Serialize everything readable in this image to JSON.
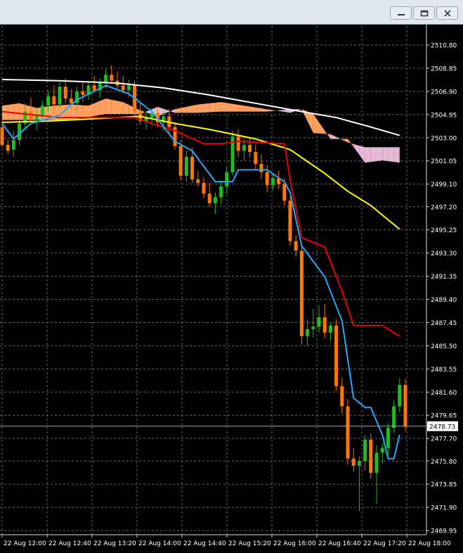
{
  "window": {
    "buttons": [
      "minimize-icon",
      "restore-icon",
      "close-icon"
    ]
  },
  "colors": {
    "background": "#000000",
    "grid": "#666666",
    "candle_bull": "#22bb22",
    "candle_bear": "#ff7700",
    "ma_long": "#ffffff",
    "ma_mid": "#ffff00",
    "kijun": "#ee0000",
    "tenkan": "#22aaff",
    "cloud_bull": "#ffa060",
    "cloud_bear": "#e6b8d6",
    "price_line": "#aaaaaa"
  },
  "chart_data": {
    "type": "candlestick",
    "y_ticks": [
      "2510.80",
      "2508.85",
      "2506.90",
      "2504.95",
      "2503.00",
      "2501.05",
      "2499.10",
      "2497.20",
      "2495.25",
      "2493.30",
      "2491.35",
      "2489.40",
      "2487.45",
      "2485.50",
      "2483.55",
      "2481.60",
      "2479.65",
      "2477.70",
      "2475.80",
      "2473.85",
      "2471.90",
      "2469.95"
    ],
    "x_ticks": [
      "22 Aug 12:00",
      "22 Aug 12:40",
      "22 Aug 13:20",
      "22 Aug 14:00",
      "22 Aug 14:40",
      "22 Aug 15:20",
      "22 Aug 16:00",
      "22 Aug 16:40",
      "22 Aug 17:20",
      "22 Aug 18:00"
    ],
    "current_price": "2478.73",
    "ylim": [
      2469.6,
      2512.4
    ],
    "candles": [
      {
        "o": 2503.9,
        "h": 2504.6,
        "l": 2502.2,
        "c": 2502.4
      },
      {
        "o": 2502.4,
        "h": 2502.9,
        "l": 2501.6,
        "c": 2501.9
      },
      {
        "o": 2502.0,
        "h": 2503.6,
        "l": 2501.4,
        "c": 2502.8
      },
      {
        "o": 2502.8,
        "h": 2504.6,
        "l": 2502.4,
        "c": 2504.2
      },
      {
        "o": 2504.2,
        "h": 2505.9,
        "l": 2503.7,
        "c": 2505.2
      },
      {
        "o": 2505.2,
        "h": 2506.4,
        "l": 2504.3,
        "c": 2504.5
      },
      {
        "o": 2504.5,
        "h": 2505.3,
        "l": 2503.6,
        "c": 2504.9
      },
      {
        "o": 2504.9,
        "h": 2506.1,
        "l": 2504.5,
        "c": 2505.7
      },
      {
        "o": 2505.7,
        "h": 2506.9,
        "l": 2505.2,
        "c": 2506.5
      },
      {
        "o": 2506.5,
        "h": 2507.4,
        "l": 2505.3,
        "c": 2505.8
      },
      {
        "o": 2505.8,
        "h": 2507.8,
        "l": 2505.4,
        "c": 2507.3
      },
      {
        "o": 2507.3,
        "h": 2508.0,
        "l": 2505.9,
        "c": 2506.3
      },
      {
        "o": 2506.3,
        "h": 2507.1,
        "l": 2505.4,
        "c": 2505.9
      },
      {
        "o": 2505.9,
        "h": 2507.3,
        "l": 2505.3,
        "c": 2506.9
      },
      {
        "o": 2506.9,
        "h": 2507.7,
        "l": 2506.0,
        "c": 2506.6
      },
      {
        "o": 2506.6,
        "h": 2507.8,
        "l": 2506.2,
        "c": 2507.4
      },
      {
        "o": 2507.4,
        "h": 2508.2,
        "l": 2506.8,
        "c": 2507.0
      },
      {
        "o": 2507.0,
        "h": 2508.0,
        "l": 2506.4,
        "c": 2507.6
      },
      {
        "o": 2507.6,
        "h": 2508.8,
        "l": 2507.2,
        "c": 2508.3
      },
      {
        "o": 2508.3,
        "h": 2509.1,
        "l": 2507.5,
        "c": 2507.8
      },
      {
        "o": 2507.8,
        "h": 2508.6,
        "l": 2507.0,
        "c": 2507.4
      },
      {
        "o": 2507.4,
        "h": 2508.2,
        "l": 2506.7,
        "c": 2507.0
      },
      {
        "o": 2507.0,
        "h": 2507.9,
        "l": 2506.4,
        "c": 2507.4
      },
      {
        "o": 2507.4,
        "h": 2507.8,
        "l": 2504.8,
        "c": 2505.2
      },
      {
        "o": 2505.2,
        "h": 2505.9,
        "l": 2504.1,
        "c": 2504.4
      },
      {
        "o": 2504.4,
        "h": 2505.2,
        "l": 2503.7,
        "c": 2504.7
      },
      {
        "o": 2504.7,
        "h": 2505.5,
        "l": 2504.0,
        "c": 2505.1
      },
      {
        "o": 2505.1,
        "h": 2505.6,
        "l": 2503.9,
        "c": 2504.3
      },
      {
        "o": 2504.3,
        "h": 2505.2,
        "l": 2503.6,
        "c": 2504.8
      },
      {
        "o": 2504.8,
        "h": 2505.4,
        "l": 2503.4,
        "c": 2503.9
      },
      {
        "o": 2503.9,
        "h": 2504.3,
        "l": 2502.0,
        "c": 2502.3
      },
      {
        "o": 2502.3,
        "h": 2502.8,
        "l": 2499.4,
        "c": 2499.8
      },
      {
        "o": 2499.8,
        "h": 2501.9,
        "l": 2499.3,
        "c": 2501.4
      },
      {
        "o": 2501.4,
        "h": 2502.2,
        "l": 2499.2,
        "c": 2499.5
      },
      {
        "o": 2499.5,
        "h": 2500.2,
        "l": 2498.9,
        "c": 2499.2
      },
      {
        "o": 2499.2,
        "h": 2499.7,
        "l": 2497.9,
        "c": 2498.3
      },
      {
        "o": 2498.3,
        "h": 2499.2,
        "l": 2497.2,
        "c": 2497.5
      },
      {
        "o": 2497.5,
        "h": 2498.4,
        "l": 2496.6,
        "c": 2498.0
      },
      {
        "o": 2498.0,
        "h": 2499.4,
        "l": 2497.4,
        "c": 2498.9
      },
      {
        "o": 2498.9,
        "h": 2500.5,
        "l": 2498.3,
        "c": 2500.1
      },
      {
        "o": 2500.1,
        "h": 2503.6,
        "l": 2499.8,
        "c": 2503.1
      },
      {
        "o": 2503.1,
        "h": 2503.7,
        "l": 2501.4,
        "c": 2501.9
      },
      {
        "o": 2501.9,
        "h": 2502.9,
        "l": 2501.1,
        "c": 2502.4
      },
      {
        "o": 2502.4,
        "h": 2503.0,
        "l": 2501.3,
        "c": 2501.8
      },
      {
        "o": 2501.8,
        "h": 2502.4,
        "l": 2500.3,
        "c": 2500.8
      },
      {
        "o": 2500.8,
        "h": 2501.6,
        "l": 2499.5,
        "c": 2500.1
      },
      {
        "o": 2500.1,
        "h": 2500.7,
        "l": 2498.4,
        "c": 2499.0
      },
      {
        "o": 2499.0,
        "h": 2500.0,
        "l": 2498.6,
        "c": 2499.6
      },
      {
        "o": 2499.6,
        "h": 2500.2,
        "l": 2498.7,
        "c": 2499.1
      },
      {
        "o": 2499.1,
        "h": 2499.6,
        "l": 2497.3,
        "c": 2497.7
      },
      {
        "o": 2497.7,
        "h": 2498.1,
        "l": 2493.9,
        "c": 2494.3
      },
      {
        "o": 2494.3,
        "h": 2494.8,
        "l": 2493.0,
        "c": 2493.5
      },
      {
        "o": 2493.5,
        "h": 2493.9,
        "l": 2485.6,
        "c": 2486.3
      },
      {
        "o": 2486.3,
        "h": 2487.7,
        "l": 2485.5,
        "c": 2486.9
      },
      {
        "o": 2486.9,
        "h": 2488.6,
        "l": 2486.2,
        "c": 2487.1
      },
      {
        "o": 2487.1,
        "h": 2488.9,
        "l": 2486.6,
        "c": 2487.9
      },
      {
        "o": 2487.9,
        "h": 2489.0,
        "l": 2486.1,
        "c": 2486.6
      },
      {
        "o": 2486.6,
        "h": 2487.5,
        "l": 2485.9,
        "c": 2487.2
      },
      {
        "o": 2487.2,
        "h": 2487.7,
        "l": 2481.7,
        "c": 2482.1
      },
      {
        "o": 2482.1,
        "h": 2482.8,
        "l": 2479.8,
        "c": 2480.4
      },
      {
        "o": 2480.4,
        "h": 2481.0,
        "l": 2475.5,
        "c": 2476.0
      },
      {
        "o": 2476.0,
        "h": 2476.9,
        "l": 2474.9,
        "c": 2475.4
      },
      {
        "o": 2475.4,
        "h": 2476.2,
        "l": 2471.6,
        "c": 2475.8
      },
      {
        "o": 2475.8,
        "h": 2478.0,
        "l": 2475.0,
        "c": 2477.6
      },
      {
        "o": 2477.6,
        "h": 2478.1,
        "l": 2474.3,
        "c": 2474.8
      },
      {
        "o": 2474.8,
        "h": 2477.1,
        "l": 2472.2,
        "c": 2476.5
      },
      {
        "o": 2476.5,
        "h": 2477.3,
        "l": 2475.6,
        "c": 2476.9
      },
      {
        "o": 2476.9,
        "h": 2479.0,
        "l": 2476.3,
        "c": 2478.6
      },
      {
        "o": 2478.6,
        "h": 2480.9,
        "l": 2478.2,
        "c": 2480.4
      },
      {
        "o": 2480.4,
        "h": 2482.8,
        "l": 2479.9,
        "c": 2482.2
      },
      {
        "o": 2482.2,
        "h": 2482.7,
        "l": 2478.3,
        "c": 2478.7
      }
    ],
    "series": [
      {
        "role": "ma_long",
        "values": [
          [
            0,
            2507.9
          ],
          [
            10,
            2507.8
          ],
          [
            20,
            2507.6
          ],
          [
            28,
            2507.2
          ],
          [
            36,
            2506.6
          ],
          [
            44,
            2505.9
          ],
          [
            52,
            2505.2
          ],
          [
            58,
            2504.7
          ],
          [
            64,
            2503.9
          ],
          [
            69,
            2503.2
          ]
        ]
      },
      {
        "role": "ma_mid",
        "values": [
          [
            0,
            2504.3
          ],
          [
            8,
            2504.4
          ],
          [
            16,
            2504.6
          ],
          [
            24,
            2504.8
          ],
          [
            30,
            2504.2
          ],
          [
            36,
            2503.7
          ],
          [
            44,
            2502.9
          ],
          [
            50,
            2502.0
          ],
          [
            56,
            2500.0
          ],
          [
            60,
            2498.5
          ],
          [
            64,
            2497.3
          ],
          [
            69,
            2495.3
          ]
        ]
      },
      {
        "role": "kijun",
        "values": [
          [
            0,
            2505.2
          ],
          [
            10,
            2504.7
          ],
          [
            23,
            2504.7
          ],
          [
            26,
            2504.2
          ],
          [
            30,
            2503.6
          ],
          [
            35,
            2502.5
          ],
          [
            38,
            2502.5
          ],
          [
            41,
            2502.7
          ],
          [
            49,
            2502.5
          ],
          [
            50,
            2499.4
          ],
          [
            52,
            2494.6
          ],
          [
            56,
            2493.8
          ],
          [
            59,
            2490.1
          ],
          [
            61,
            2487.2
          ],
          [
            66,
            2487.2
          ],
          [
            69,
            2486.3
          ]
        ]
      },
      {
        "role": "tenkan",
        "values": [
          [
            0,
            2504.2
          ],
          [
            2,
            2502.9
          ],
          [
            5,
            2504.2
          ],
          [
            10,
            2504.9
          ],
          [
            13,
            2506.2
          ],
          [
            18,
            2507.4
          ],
          [
            22,
            2506.7
          ],
          [
            26,
            2505.2
          ],
          [
            30,
            2502.7
          ],
          [
            33,
            2501.9
          ],
          [
            37,
            2499.3
          ],
          [
            40,
            2499.3
          ],
          [
            41,
            2500.3
          ],
          [
            46,
            2500.3
          ],
          [
            49,
            2499.3
          ],
          [
            50,
            2498.4
          ],
          [
            52,
            2493.9
          ],
          [
            56,
            2491.3
          ],
          [
            59,
            2487.6
          ],
          [
            61,
            2481.1
          ],
          [
            63,
            2480.3
          ],
          [
            64,
            2480.3
          ],
          [
            66,
            2478.0
          ],
          [
            67,
            2476.0
          ],
          [
            68,
            2476.0
          ],
          [
            69,
            2478.0
          ]
        ]
      },
      {
        "role": "cloud_a",
        "values": [
          [
            0,
            2505.7
          ],
          [
            3,
            2505.9
          ],
          [
            6,
            2505.5
          ],
          [
            9,
            2505.7
          ],
          [
            12,
            2505.8
          ],
          [
            15,
            2505.7
          ],
          [
            18,
            2506.3
          ],
          [
            21,
            2506.0
          ],
          [
            24,
            2505.3
          ],
          [
            27,
            2504.8
          ],
          [
            30,
            2505.4
          ],
          [
            34,
            2505.8
          ],
          [
            38,
            2506.0
          ],
          [
            42,
            2505.7
          ],
          [
            46,
            2505.4
          ],
          [
            50,
            2505.1
          ],
          [
            52,
            2505.4
          ],
          [
            54,
            2505.0
          ],
          [
            57,
            2502.9
          ],
          [
            60,
            2502.9
          ],
          [
            63,
            2500.9
          ],
          [
            66,
            2501.1
          ],
          [
            69,
            2500.9
          ]
        ]
      },
      {
        "role": "cloud_b",
        "values": [
          [
            0,
            2504.5
          ],
          [
            6,
            2504.5
          ],
          [
            12,
            2504.5
          ],
          [
            18,
            2505.0
          ],
          [
            24,
            2505.0
          ],
          [
            27,
            2505.6
          ],
          [
            30,
            2505.1
          ],
          [
            34,
            2505.1
          ],
          [
            38,
            2505.2
          ],
          [
            42,
            2505.2
          ],
          [
            46,
            2505.2
          ],
          [
            50,
            2505.4
          ],
          [
            52,
            2505.4
          ],
          [
            54,
            2503.4
          ],
          [
            57,
            2503.3
          ],
          [
            60,
            2502.6
          ],
          [
            63,
            2502.2
          ],
          [
            66,
            2502.2
          ],
          [
            69,
            2502.2
          ]
        ]
      }
    ]
  }
}
